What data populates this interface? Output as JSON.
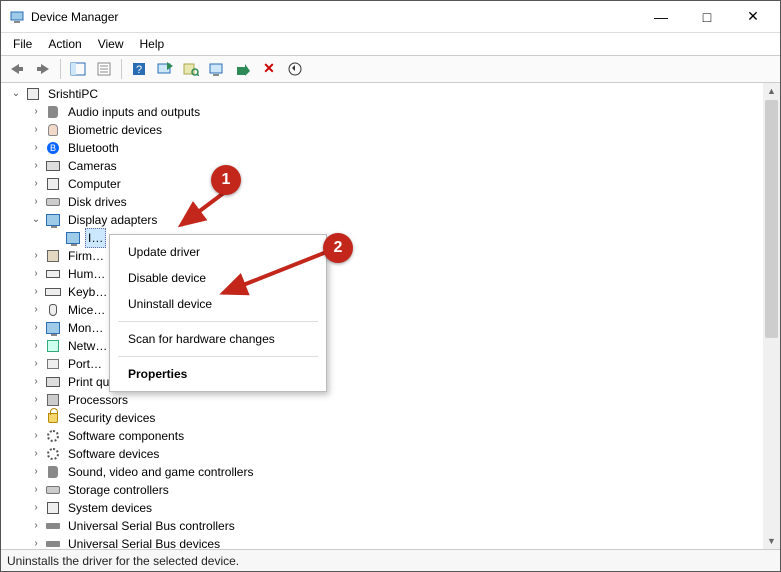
{
  "window": {
    "title": "Device Manager",
    "controls": {
      "min": "—",
      "max": "□",
      "close": "✕"
    }
  },
  "menu": {
    "file": "File",
    "action": "Action",
    "view": "View",
    "help": "Help"
  },
  "toolbar_icons": {
    "back": "back-icon",
    "forward": "forward-icon",
    "show_hide": "show-hide-tree-icon",
    "properties": "properties-icon",
    "help": "help-icon",
    "update": "update-driver-icon",
    "scan": "scan-hardware-icon",
    "monitor": "add-legacy-icon",
    "enable": "enable-icon",
    "remove": "uninstall-icon",
    "print": "print-icon"
  },
  "tree": {
    "root": "SrishtiPC",
    "categories": [
      {
        "label": "Audio inputs and outputs",
        "icon": "speaker"
      },
      {
        "label": "Biometric devices",
        "icon": "finger"
      },
      {
        "label": "Bluetooth",
        "icon": "blue"
      },
      {
        "label": "Cameras",
        "icon": "camera"
      },
      {
        "label": "Computer",
        "icon": "pc"
      },
      {
        "label": "Disk drives",
        "icon": "disk"
      },
      {
        "label": "Display adapters",
        "icon": "monitor",
        "expanded": true,
        "selected_child": "I…"
      },
      {
        "label": "Firm…",
        "icon": "firmware"
      },
      {
        "label": "Hum…",
        "icon": "hid"
      },
      {
        "label": "Keyb…",
        "icon": "keyboard"
      },
      {
        "label": "Mice…",
        "icon": "mouse"
      },
      {
        "label": "Mon…",
        "icon": "monitor"
      },
      {
        "label": "Netw…",
        "icon": "net"
      },
      {
        "label": "Port…",
        "icon": "port"
      },
      {
        "label": "Print queues",
        "icon": "printer"
      },
      {
        "label": "Processors",
        "icon": "chip"
      },
      {
        "label": "Security devices",
        "icon": "lock"
      },
      {
        "label": "Software components",
        "icon": "gear"
      },
      {
        "label": "Software devices",
        "icon": "gear"
      },
      {
        "label": "Sound, video and game controllers",
        "icon": "speaker"
      },
      {
        "label": "Storage controllers",
        "icon": "disk"
      },
      {
        "label": "System devices",
        "icon": "pc"
      },
      {
        "label": "Universal Serial Bus controllers",
        "icon": "usb"
      },
      {
        "label": "Universal Serial Bus devices",
        "icon": "usb"
      }
    ]
  },
  "context_menu": {
    "items": [
      {
        "label": "Update driver"
      },
      {
        "label": "Disable device"
      },
      {
        "label": "Uninstall device"
      },
      {
        "divider": true
      },
      {
        "label": "Scan for hardware changes"
      },
      {
        "divider": true
      },
      {
        "label": "Properties",
        "bold": true
      }
    ]
  },
  "annotations": {
    "1": "1",
    "2": "2"
  },
  "statusbar": "Uninstalls the driver for the selected device."
}
